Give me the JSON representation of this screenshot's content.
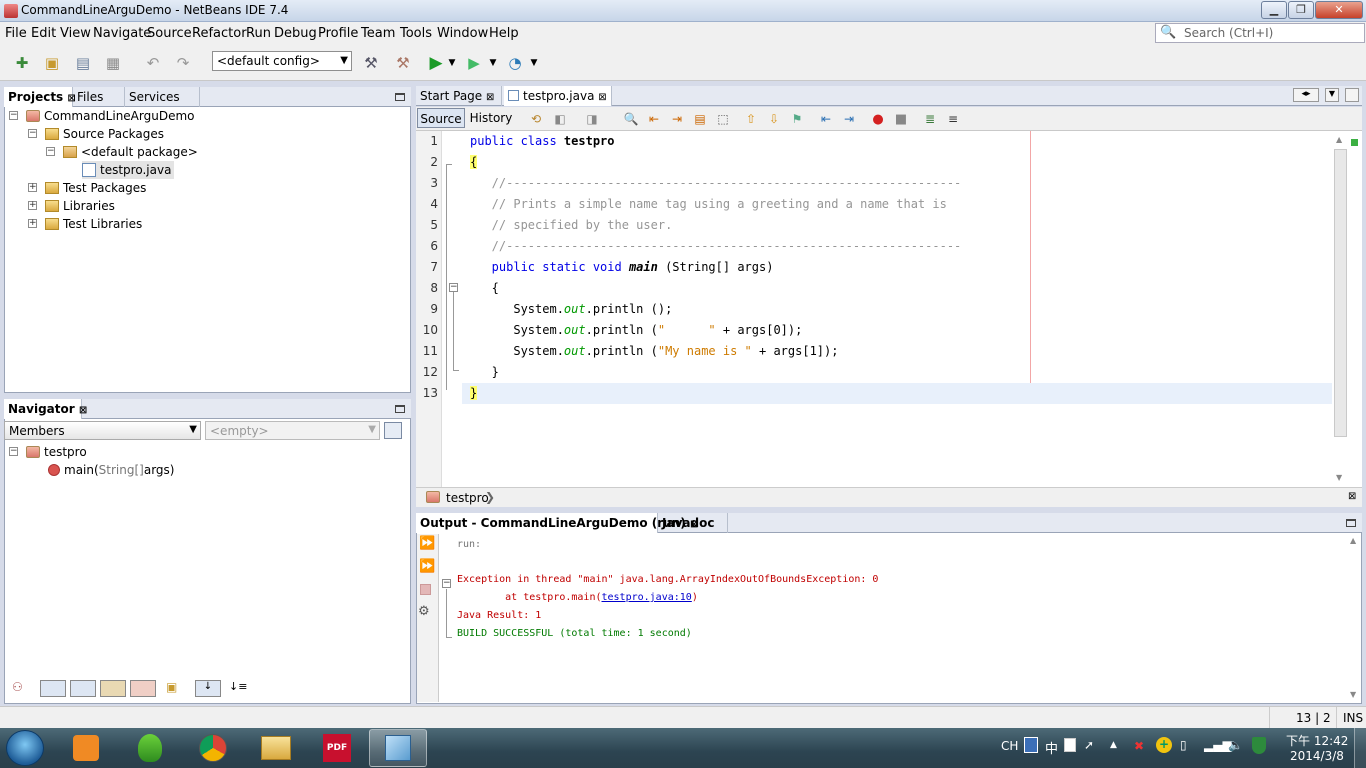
{
  "window": {
    "title": "CommandLineArguDemo - NetBeans IDE 7.4"
  },
  "menubar": {
    "items": [
      "File",
      "Edit",
      "View",
      "Navigate",
      "Source",
      "Refactor",
      "Run",
      "Debug",
      "Profile",
      "Team",
      "Tools",
      "Window",
      "Help"
    ]
  },
  "search": {
    "placeholder": "Search (Ctrl+I)"
  },
  "toolbar": {
    "config": "<default config>"
  },
  "projects_panel": {
    "tabs": [
      "Projects",
      "Files",
      "Services"
    ],
    "tree": [
      {
        "label": "CommandLineArguDemo",
        "icon": "project-icon"
      },
      {
        "label": "Source Packages",
        "icon": "folder-icon"
      },
      {
        "label": "<default package>",
        "icon": "package-icon"
      },
      {
        "label": "testpro.java",
        "icon": "java-file-icon"
      },
      {
        "label": "Test Packages",
        "icon": "folder-icon"
      },
      {
        "label": "Libraries",
        "icon": "folder-icon"
      },
      {
        "label": "Test Libraries",
        "icon": "folder-icon"
      }
    ]
  },
  "navigator": {
    "title": "Navigator",
    "filter": "Members",
    "scope": "<empty>",
    "root": "testpro",
    "method_name": "main(",
    "method_params": "String[]",
    "method_rest": " args)"
  },
  "editor": {
    "tabs": [
      "Start Page",
      "testpro.java"
    ],
    "source_tab": "Source",
    "history_tab": "History",
    "line_numbers": [
      "1",
      "2",
      "3",
      "4",
      "5",
      "6",
      "7",
      "8",
      "9",
      "10",
      "11",
      "12",
      "13"
    ],
    "code": {
      "l1_kw": "public class ",
      "l1_name": "testpro",
      "l2": "{",
      "l3": "   //---------------------------------------------------------------",
      "l4": "   // Prints a simple name tag using a greeting and a name that is",
      "l5": "   // specified by the user.",
      "l6": "   //---------------------------------------------------------------",
      "l7_kw": "   public static void ",
      "l7_name": "main",
      "l7_rest": " (String[] args)",
      "l8": "   {",
      "l9_a": "      System.",
      "l9_f": "out",
      "l9_b": ".println ();",
      "l10_a": "      System.",
      "l10_f": "out",
      "l10_b": ".println (",
      "l10_s": "\"      \"",
      "l10_c": " + args[0]);",
      "l11_a": "      System.",
      "l11_f": "out",
      "l11_b": ".println (",
      "l11_s": "\"My name is \"",
      "l11_c": " + args[1]);",
      "l12": "   }",
      "l13": "}"
    },
    "breadcrumb": "testpro"
  },
  "output": {
    "tabs": [
      "Output - CommandLineArguDemo (run)",
      "Javadoc"
    ],
    "run": "run:",
    "exception": "Exception in thread \"main\" java.lang.ArrayIndexOutOfBoundsException: 0",
    "at_prefix": "        at testpro.main(",
    "at_link": "testpro.java:10",
    "at_suffix": ")",
    "java_result": "Java Result: 1",
    "build": "BUILD SUCCESSFUL (total time: 1 second)"
  },
  "statusbar": {
    "position": "13 | 2",
    "mode": "INS"
  },
  "taskbar": {
    "lang": "CH",
    "ime": "中",
    "time": "下午 12:42",
    "date": "2014/3/8"
  }
}
